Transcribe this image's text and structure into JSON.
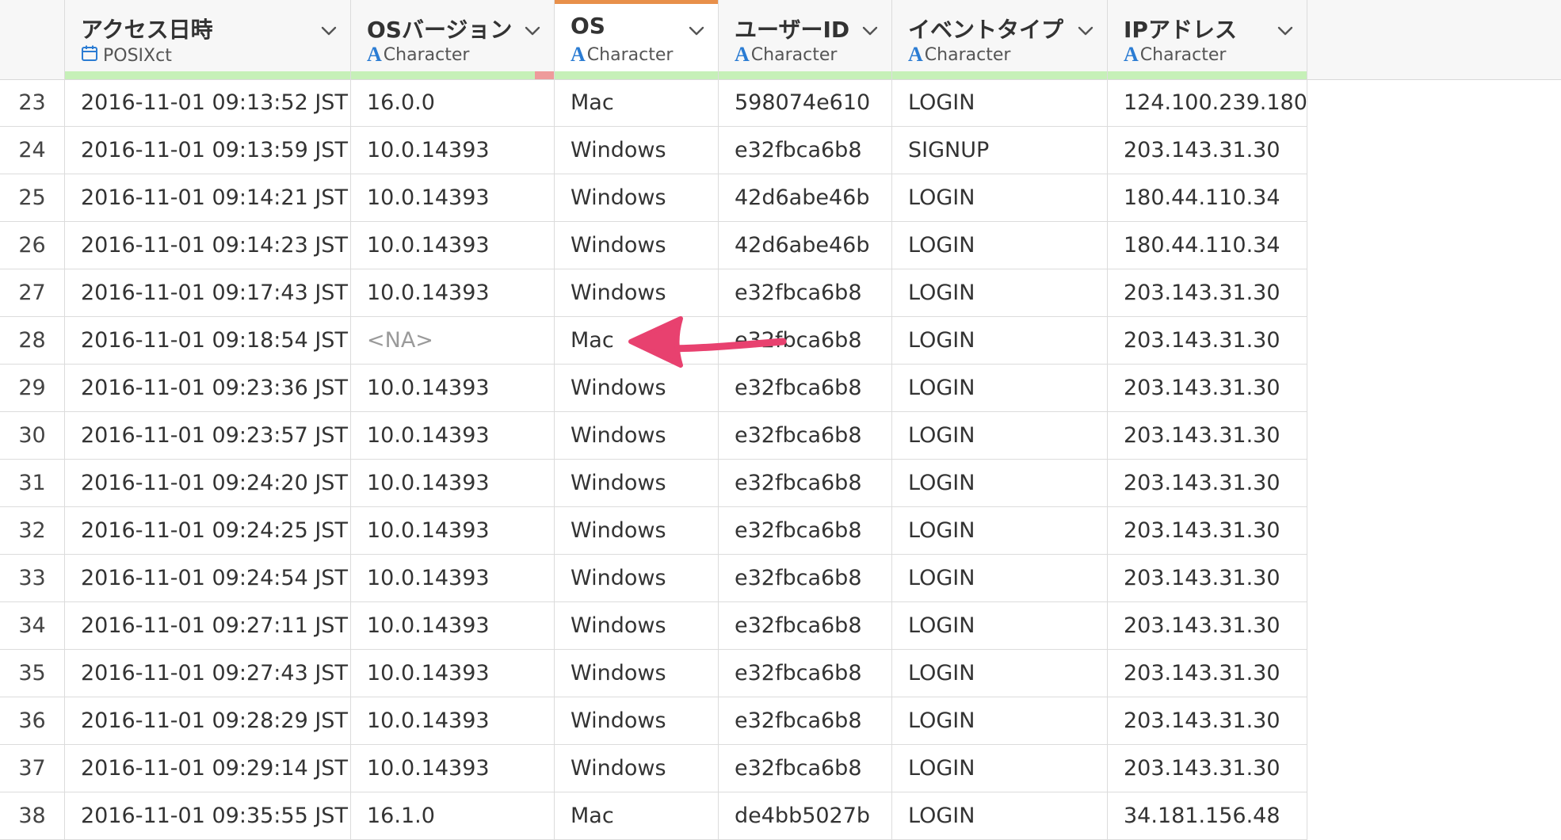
{
  "columns": [
    {
      "name": "アクセス日時",
      "type": "POSIXct",
      "type_icon": "calendar-icon"
    },
    {
      "name": "OSバージョン",
      "type": "Character",
      "type_icon": "character-type-icon"
    },
    {
      "name": "OS",
      "type": "Character",
      "type_icon": "character-type-icon"
    },
    {
      "name": "ユーザーID",
      "type": "Character",
      "type_icon": "character-type-icon"
    },
    {
      "name": "イベントタイプ",
      "type": "Character",
      "type_icon": "character-type-icon"
    },
    {
      "name": "IPアドレス",
      "type": "Character",
      "type_icon": "character-type-icon"
    }
  ],
  "rows": [
    {
      "num": "23",
      "cells": [
        "2016-11-01 09:13:52 JST",
        "16.0.0",
        "Mac",
        "598074e610",
        "LOGIN",
        "124.100.239.180"
      ]
    },
    {
      "num": "24",
      "cells": [
        "2016-11-01 09:13:59 JST",
        "10.0.14393",
        "Windows",
        "e32fbca6b8",
        "SIGNUP",
        "203.143.31.30"
      ]
    },
    {
      "num": "25",
      "cells": [
        "2016-11-01 09:14:21 JST",
        "10.0.14393",
        "Windows",
        "42d6abe46b",
        "LOGIN",
        "180.44.110.34"
      ]
    },
    {
      "num": "26",
      "cells": [
        "2016-11-01 09:14:23 JST",
        "10.0.14393",
        "Windows",
        "42d6abe46b",
        "LOGIN",
        "180.44.110.34"
      ]
    },
    {
      "num": "27",
      "cells": [
        "2016-11-01 09:17:43 JST",
        "10.0.14393",
        "Windows",
        "e32fbca6b8",
        "LOGIN",
        "203.143.31.30"
      ]
    },
    {
      "num": "28",
      "cells": [
        "2016-11-01 09:18:54 JST",
        "<NA>",
        "Mac",
        "e32fbca6b8",
        "LOGIN",
        "203.143.31.30"
      ]
    },
    {
      "num": "29",
      "cells": [
        "2016-11-01 09:23:36 JST",
        "10.0.14393",
        "Windows",
        "e32fbca6b8",
        "LOGIN",
        "203.143.31.30"
      ]
    },
    {
      "num": "30",
      "cells": [
        "2016-11-01 09:23:57 JST",
        "10.0.14393",
        "Windows",
        "e32fbca6b8",
        "LOGIN",
        "203.143.31.30"
      ]
    },
    {
      "num": "31",
      "cells": [
        "2016-11-01 09:24:20 JST",
        "10.0.14393",
        "Windows",
        "e32fbca6b8",
        "LOGIN",
        "203.143.31.30"
      ]
    },
    {
      "num": "32",
      "cells": [
        "2016-11-01 09:24:25 JST",
        "10.0.14393",
        "Windows",
        "e32fbca6b8",
        "LOGIN",
        "203.143.31.30"
      ]
    },
    {
      "num": "33",
      "cells": [
        "2016-11-01 09:24:54 JST",
        "10.0.14393",
        "Windows",
        "e32fbca6b8",
        "LOGIN",
        "203.143.31.30"
      ]
    },
    {
      "num": "34",
      "cells": [
        "2016-11-01 09:27:11 JST",
        "10.0.14393",
        "Windows",
        "e32fbca6b8",
        "LOGIN",
        "203.143.31.30"
      ]
    },
    {
      "num": "35",
      "cells": [
        "2016-11-01 09:27:43 JST",
        "10.0.14393",
        "Windows",
        "e32fbca6b8",
        "LOGIN",
        "203.143.31.30"
      ]
    },
    {
      "num": "36",
      "cells": [
        "2016-11-01 09:28:29 JST",
        "10.0.14393",
        "Windows",
        "e32fbca6b8",
        "LOGIN",
        "203.143.31.30"
      ]
    },
    {
      "num": "37",
      "cells": [
        "2016-11-01 09:29:14 JST",
        "10.0.14393",
        "Windows",
        "e32fbca6b8",
        "LOGIN",
        "203.143.31.30"
      ]
    },
    {
      "num": "38",
      "cells": [
        "2016-11-01 09:35:55 JST",
        "16.1.0",
        "Mac",
        "de4bb5027b",
        "LOGIN",
        "34.181.156.48"
      ]
    }
  ],
  "colors": {
    "selected_column_accent": "#e8904a",
    "type_icon": "#2b7cd3",
    "quality_ok": "#c6f0b8",
    "quality_missing": "#ee9b9b",
    "annotation_arrow": "#e8416f",
    "na_text": "#9a9a9a"
  },
  "selected_column": "OS",
  "annotation": "arrow pointing to OS cell \"Mac\" in row 28"
}
